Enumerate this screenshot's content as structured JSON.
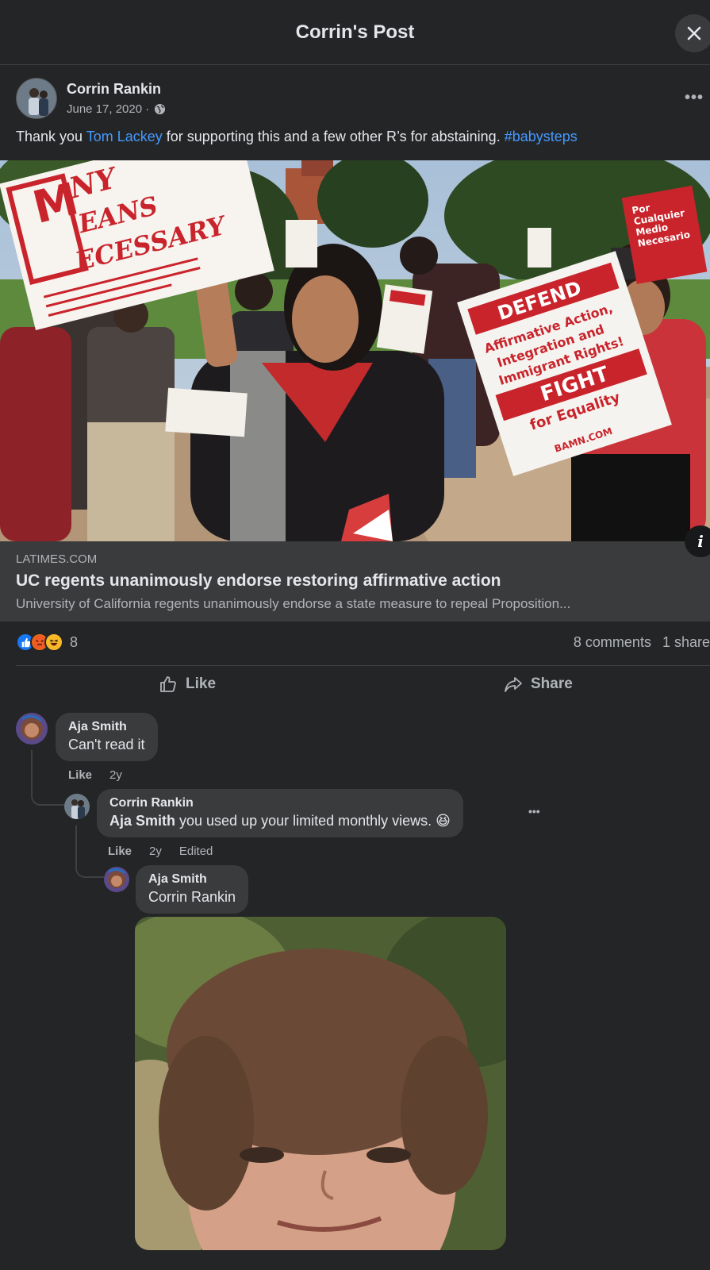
{
  "header": {
    "title": "Corrin's Post"
  },
  "post": {
    "author": "Corrin Rankin",
    "date": "June 17, 2020 ·",
    "text_before": "Thank you ",
    "mention": "Tom Lackey",
    "text_middle": " for supporting this and a few other R’s for abstaining. ",
    "hashtag": "#babysteps",
    "image_sign_1": [
      "NY",
      "EANS",
      "ECESSARY"
    ],
    "image_sign_2": [
      "DEFEND",
      "Affirmative Action,",
      "Integration and",
      "Immigrant Rights!",
      "FIGHT",
      "for Equality",
      "BAMN.COM"
    ],
    "image_sign_3": [
      "Por",
      "Cualquier",
      "Medio",
      "Necesario"
    ]
  },
  "link_preview": {
    "domain": "LATIMES.COM",
    "title": "UC regents unanimously endorse restoring affirmative action",
    "description": "University of California regents unanimously endorse a state measure to repeal Proposition..."
  },
  "stats": {
    "reaction_count": "8",
    "comments": "8 comments",
    "shares": "1 share"
  },
  "actions": {
    "like": "Like",
    "share": "Share"
  },
  "comments": [
    {
      "name": "Aja Smith",
      "text": "Can't read it",
      "like": "Like",
      "time": "2y"
    },
    {
      "name": "Corrin Rankin",
      "mention": "Aja Smith",
      "text": " you used up your limited monthly views. ",
      "emoji": "😆",
      "like": "Like",
      "time": "2y",
      "edited": "Edited"
    },
    {
      "name": "Aja Smith",
      "mention": "Corrin Rankin"
    }
  ],
  "colors": {
    "background": "#242526",
    "bubble": "#3a3b3c",
    "link": "#4599ff",
    "muted": "#b0b3b8"
  }
}
